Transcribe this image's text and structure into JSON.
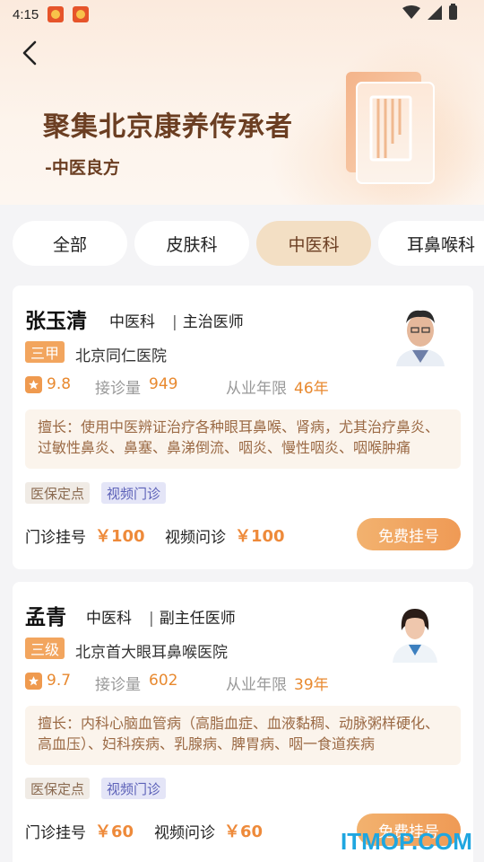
{
  "status_bar": {
    "time": "4:15"
  },
  "banner": {
    "title": "聚集北京康养传承者",
    "subtitle": "-中医良方"
  },
  "tabs": [
    {
      "label": "全部",
      "active": false
    },
    {
      "label": "皮肤科",
      "active": false
    },
    {
      "label": "中医科",
      "active": true
    },
    {
      "label": "耳鼻喉科",
      "active": false
    }
  ],
  "doctors": [
    {
      "name": "张玉清",
      "department": "中医科",
      "title": "主治医师",
      "level": "三甲",
      "hospital": "北京同仁医院",
      "rating": "9.8",
      "consult_label": "接诊量",
      "consult_count": "949",
      "years_label": "从业年限",
      "years": "46年",
      "expertise": "擅长：使用中医辨证治疗各种眼耳鼻喉、肾病，尤其治疗鼻炎、过敏性鼻炎、鼻塞、鼻涕倒流、咽炎、慢性咽炎、咽喉肿痛",
      "tags": [
        "医保定点",
        "视频门诊"
      ],
      "clinic_label": "门诊挂号",
      "clinic_fee": "￥100",
      "video_label": "视频问诊",
      "video_fee": "￥100",
      "button": "免费挂号"
    },
    {
      "name": "孟青",
      "department": "中医科",
      "title": "副主任医师",
      "level": "三级",
      "hospital": "北京首大眼耳鼻喉医院",
      "rating": "9.7",
      "consult_label": "接诊量",
      "consult_count": "602",
      "years_label": "从业年限",
      "years": "39年",
      "expertise": "擅长：内科心脑血管病（高脂血症、血液黏稠、动脉粥样硬化、高血压）、妇科疾病、乳腺病、脾胃病、咽一食道疾病",
      "tags": [
        "医保定点",
        "视频门诊"
      ],
      "clinic_label": "门诊挂号",
      "clinic_fee": "￥60",
      "video_label": "视频问诊",
      "video_fee": "￥60",
      "button": "免费挂号"
    }
  ],
  "watermark": "ITMOP.COM"
}
